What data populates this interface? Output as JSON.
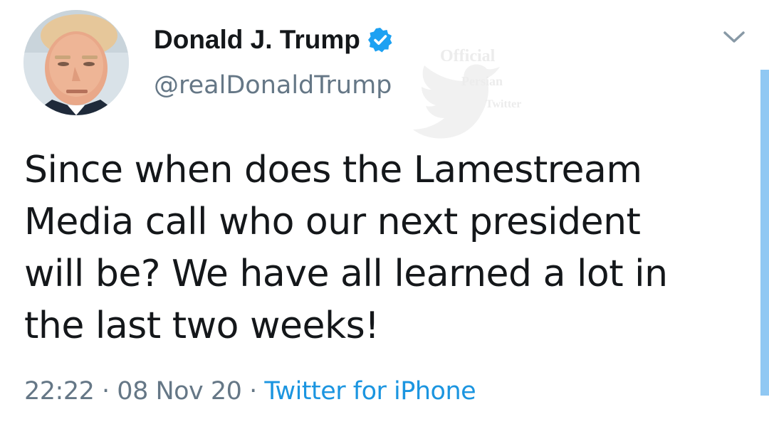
{
  "author": {
    "display_name": "Donald J. Trump",
    "handle": "@realDonaldTrump",
    "verified": true
  },
  "watermark": {
    "lines": [
      "Official",
      "Persian",
      "Twitter"
    ]
  },
  "tweet": {
    "lines": [
      "Since when does the Lamestream",
      "Media call who our next president",
      "will be? We have all learned a lot in",
      "the last two weeks!"
    ]
  },
  "meta": {
    "time": "22:22",
    "separator": "·",
    "date": "08 Nov 20",
    "source": "Twitter for iPhone"
  },
  "icons": {
    "verified": "verified-badge-icon",
    "menu": "chevron-down-icon"
  },
  "colors": {
    "link": "#1b95e0",
    "verified": "#1da1f2",
    "secondary_text": "#657786",
    "scroll_indicator": "#90c8f3"
  }
}
